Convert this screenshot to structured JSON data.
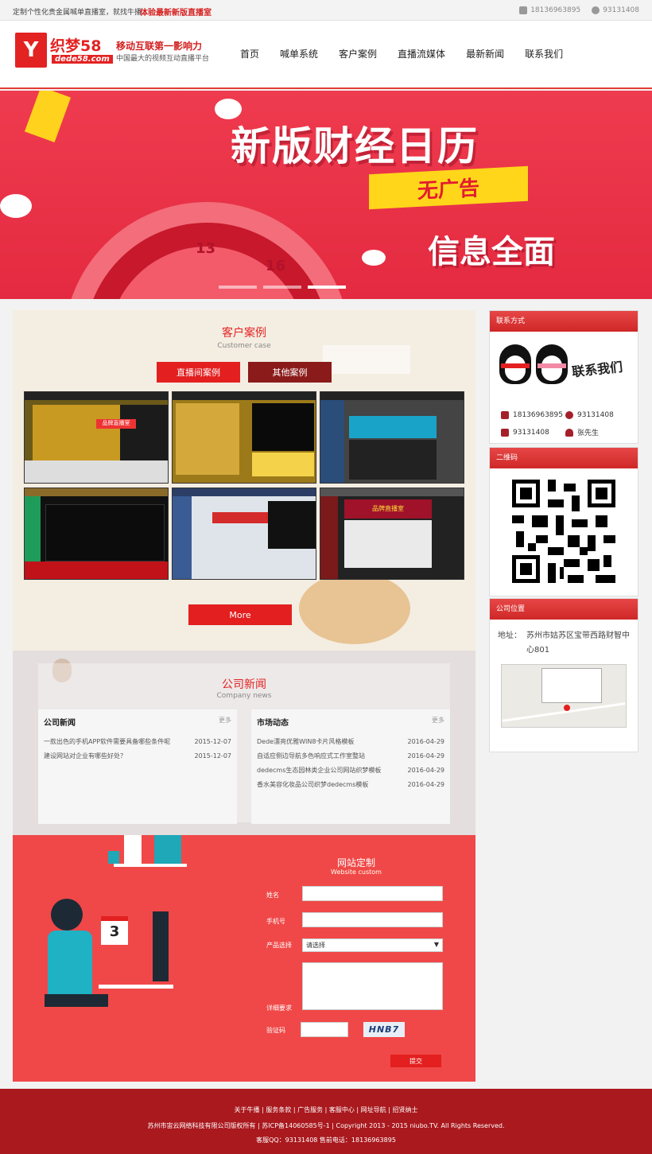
{
  "topbar": {
    "left_text": "定制个性化贵金属喊单直播室，就找牛播",
    "promo_link": "体验最新新版直播室",
    "phone": "18136963895",
    "qq": "93131408"
  },
  "header": {
    "logo_mark": "Y",
    "logo_name": "织梦58",
    "logo_domain": "dede58.com",
    "slogan_main": "移动互联第一影响力",
    "slogan_sub": "中国最大的视频互动直播平台"
  },
  "nav": {
    "items": [
      {
        "label": "首页"
      },
      {
        "label": "喊单系统"
      },
      {
        "label": "客户案例"
      },
      {
        "label": "直播流媒体"
      },
      {
        "label": "最新新闻"
      },
      {
        "label": "联系我们"
      }
    ]
  },
  "banner": {
    "title": "新版财经日历",
    "highlight": "无广告",
    "subtitle": "信息全面",
    "clock_numbers": [
      "13",
      "16"
    ],
    "active_slide": 2,
    "slide_count": 3
  },
  "cases": {
    "title": "客户案例",
    "subtitle": "Customer case",
    "tab_live": "直播间案例",
    "tab_other": "其他案例",
    "more_label": "More",
    "thumb_captions": [
      "品牌直播室",
      "",
      "",
      "",
      "",
      "品牌直播室"
    ]
  },
  "company_news": {
    "title": "公司新闻",
    "subtitle": "Company news",
    "boxes": [
      {
        "heading": "公司新闻",
        "more": "更多",
        "items": [
          {
            "title": "一款出色的手机APP软件需要具备哪些条件呢",
            "date": "2015-12-07"
          },
          {
            "title": "建设网站对企业有哪些好处？",
            "date": "2015-12-07"
          }
        ]
      },
      {
        "heading": "市场动态",
        "more": "更多",
        "items": [
          {
            "title": "Dede漂亮优雅WIN8卡片风格模板",
            "date": "2016-04-29"
          },
          {
            "title": "自适应侧边导航多色响应式工作室整站",
            "date": "2016-04-29"
          },
          {
            "title": "dedecms生态园林类企业公司网站织梦模板",
            "date": "2016-04-29"
          },
          {
            "title": "香水美容化妆品公司织梦dedecms模板",
            "date": "2016-04-29"
          }
        ]
      }
    ]
  },
  "custom_form": {
    "title": "网站定制",
    "subtitle": "Website custom",
    "name_label": "姓名",
    "phone_label": "手机号",
    "product_label": "产品选择",
    "product_selected": "请选择",
    "detail_label": "详细要求",
    "captcha_label": "验证码",
    "captcha_text": "HNB7",
    "submit_label": "提交",
    "calendar_day": "3"
  },
  "sidebar": {
    "contact_heading": "联系方式",
    "contact_us_text": "联系我们",
    "phone": "18136963895",
    "qq": "93131408",
    "fax": "93131408",
    "person": "张先生",
    "qr_heading": "二维码",
    "location_heading": "公司位置",
    "address_label": "地址：",
    "address": "苏州市姑苏区宝带西路财智中心801"
  },
  "footer": {
    "links": "关于牛播 | 服务条款 | 广告服务 | 客服中心 | 网址导航 | 招贤纳士",
    "copyright": "苏州市宙云网络科技有限公司版权所有 | 苏ICP备14060585号-1 | Copyright 2013 - 2015 niubo.TV. All Rights Reserved.",
    "contact": "客服QQ：93131408 售前电话：18136963895"
  },
  "colors": {
    "brand_red": "#e32222",
    "banner_red": "#e42a40",
    "footer_red": "#a9191e",
    "highlight_yellow": "#ffd61a",
    "tab_dark": "#8b1a1a"
  },
  "icons": [
    "phone-icon",
    "qq-icon",
    "fax-icon",
    "user-icon"
  ]
}
